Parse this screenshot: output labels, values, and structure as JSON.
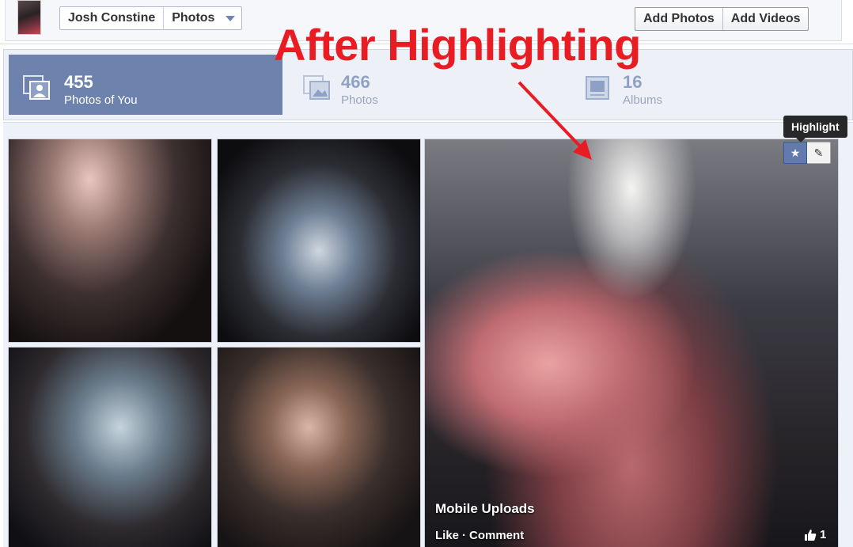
{
  "header": {
    "profile_name": "Josh Constine",
    "section_select": "Photos",
    "buttons": [
      "Add Photos",
      "Add Videos"
    ]
  },
  "annotation": {
    "text": "After Highlighting",
    "color": "#ea1c23"
  },
  "stats": [
    {
      "count": "455",
      "label": "Photos of You",
      "icon": "photos-of-you-icon",
      "active": true
    },
    {
      "count": "466",
      "label": "Photos",
      "icon": "photos-icon",
      "active": false
    },
    {
      "count": "16",
      "label": "Albums",
      "icon": "albums-icon",
      "active": false
    }
  ],
  "featured_photo": {
    "tooltip": "Highlight",
    "tools": [
      "star-icon",
      "pencil-icon"
    ],
    "album_title": "Mobile Uploads",
    "actions": [
      "Like",
      "·",
      "Comment"
    ],
    "like_count": "1"
  },
  "colors": {
    "active_tab": "#6d83ad",
    "accent": "#3b5998",
    "annotation_red": "#ea1c23"
  }
}
